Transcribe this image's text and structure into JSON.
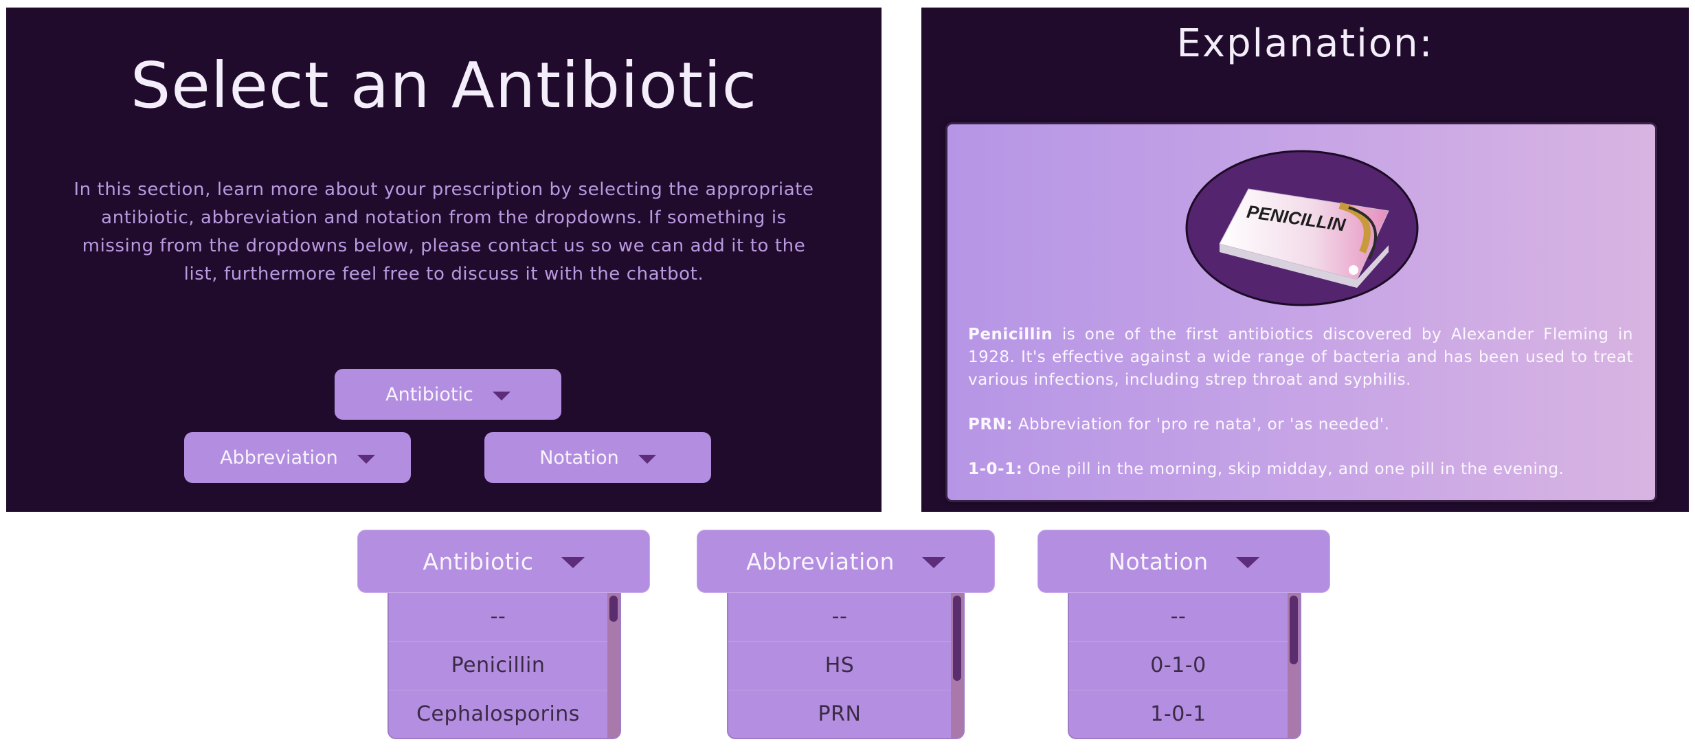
{
  "selector": {
    "title": "Select an Antibiotic",
    "intro": "In this section, learn more about your prescription by selecting the appropriate antibiotic, abbreviation and notation from the dropdowns. If something is missing from the dropdowns below, please contact us so we can add it to the list, furthermore feel free to discuss it with the chatbot.",
    "antibiotic_label": "Antibiotic",
    "abbreviation_label": "Abbreviation",
    "notation_label": "Notation"
  },
  "explanation": {
    "title": "Explanation:",
    "image_label": "PENICILLIN",
    "p1_term": "Penicillin",
    "p1_text": " is one of the first antibiotics discovered by Alexander Fleming in 1928. It's effective against a wide range of bacteria and has been used to treat various infections, including strep throat and syphilis.",
    "p2_term": "PRN:",
    "p2_text": " Abbreviation for 'pro re nata', or 'as needed'.",
    "p3_term": "1-0-1:",
    "p3_text": " One pill in the morning, skip midday, and one pill in the evening."
  },
  "dropdowns": {
    "antibiotic": {
      "label": "Antibiotic",
      "options": [
        "--",
        "Penicillin",
        "Cephalosporins"
      ]
    },
    "abbreviation": {
      "label": "Abbreviation",
      "options": [
        "--",
        "HS",
        "PRN"
      ]
    },
    "notation": {
      "label": "Notation",
      "options": [
        "--",
        "0-1-0",
        "1-0-1"
      ]
    }
  },
  "colors": {
    "panel_bg": "#200b2c",
    "button_bg": "#b28de0",
    "accent_dark": "#5d2c7a",
    "intro_text": "#b99ae0"
  }
}
